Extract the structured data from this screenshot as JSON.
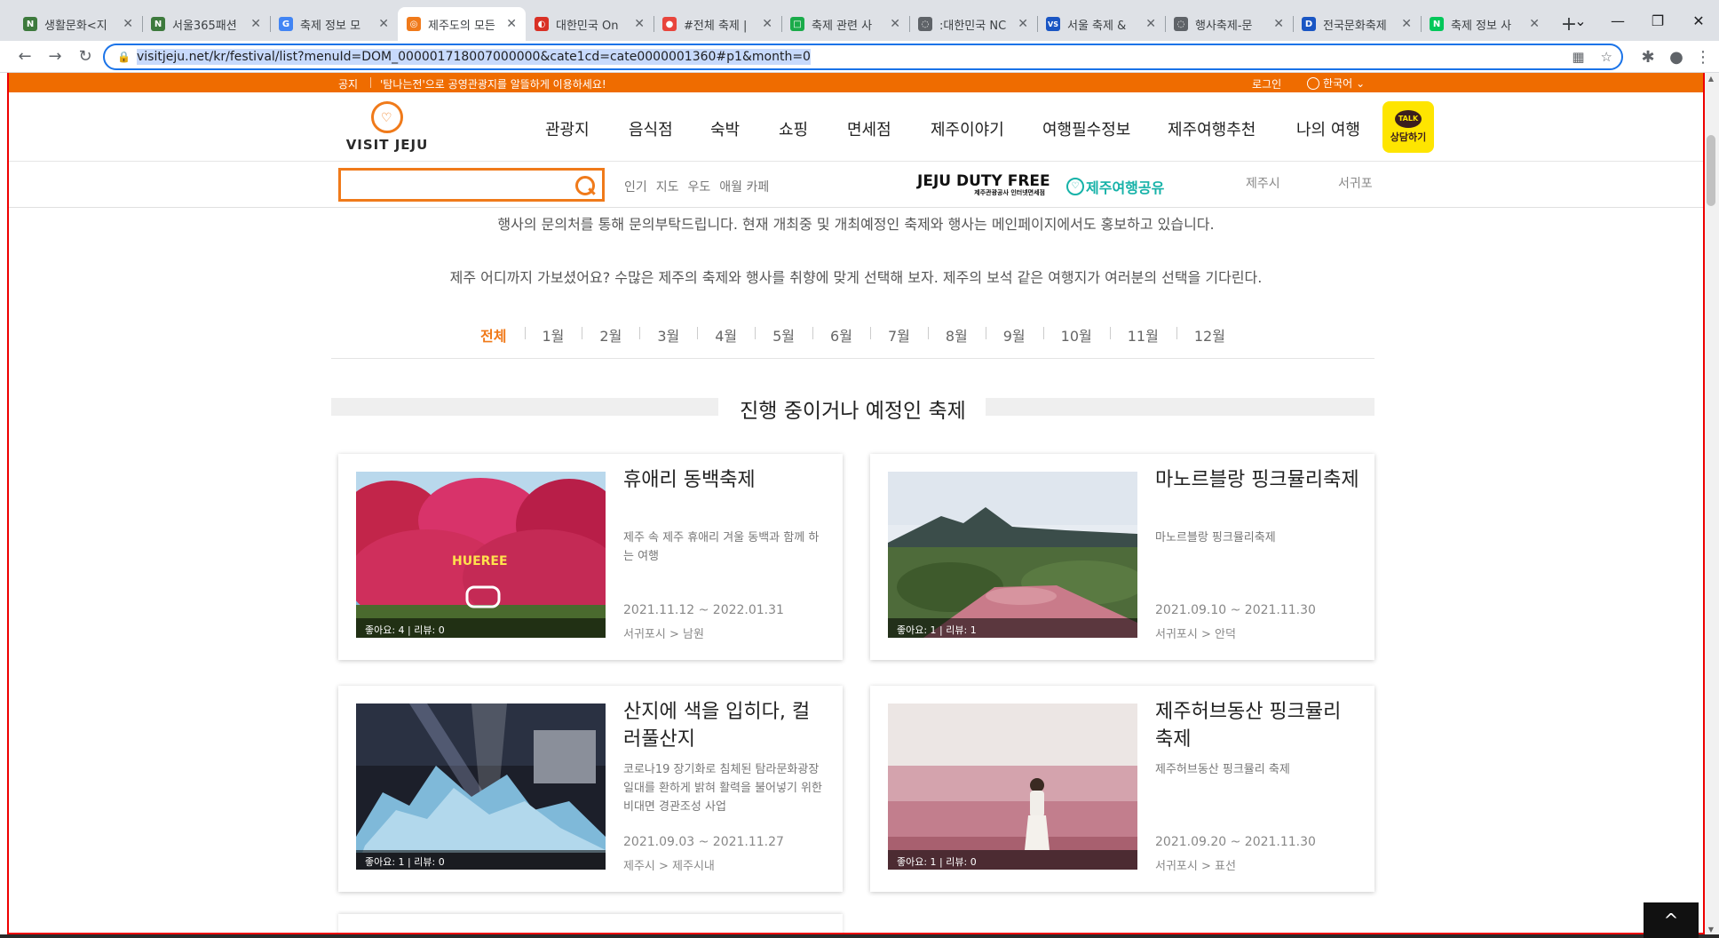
{
  "browser": {
    "tabs": [
      {
        "title": "생활문화<지",
        "fav": "N",
        "color": "#3d7a3d"
      },
      {
        "title": "서울365패션",
        "fav": "N",
        "color": "#3d7a3d"
      },
      {
        "title": "축제 정보 모",
        "fav": "G",
        "color": "#4285f4"
      },
      {
        "title": "제주도의 모든",
        "fav": "◎",
        "color": "#f07a1a"
      },
      {
        "title": "대한민국 On",
        "fav": "◐",
        "color": "#d93025"
      },
      {
        "title": "#전체 축제 |",
        "fav": "●",
        "color": "#e8453c"
      },
      {
        "title": "축제 관련 사",
        "fav": "□",
        "color": "#1aab4a"
      },
      {
        "title": ":대한민국 NC",
        "fav": "◌",
        "color": "#5f6368"
      },
      {
        "title": "서울 축제 &",
        "fav": "VS",
        "color": "#1a56c4"
      },
      {
        "title": "행사축제-문",
        "fav": "◌",
        "color": "#5f6368"
      },
      {
        "title": "전국문화축제",
        "fav": "D",
        "color": "#1a56c4"
      },
      {
        "title": "축제 정보 사",
        "fav": "N",
        "color": "#03c75a"
      }
    ],
    "active_tab": 3,
    "new_tab": "+",
    "url": "visitjeju.net/kr/festival/list?menuId=DOM_000001718007000000&cate1cd=cate0000001360#p1&month=0"
  },
  "notice": {
    "label": "공지",
    "text": "'탐나는전'으로 공영관광지를 알뜰하게 이용하세요!",
    "login": "로그인",
    "language": "한국어"
  },
  "header": {
    "logo": "VISIT JEJU",
    "nav": [
      "관광지",
      "음식점",
      "숙박",
      "쇼핑",
      "면세점",
      "제주이야기",
      "여행필수정보",
      "제주여행추천",
      "나의 여행"
    ],
    "kakao_talk": "TALK",
    "kakao_label": "상담하기"
  },
  "subbar": {
    "search_value": "",
    "hot_keywords": [
      "인기",
      "지도",
      "우도",
      "애월 카페"
    ],
    "dutyfree_main": "JEJU DUTY FREE",
    "dutyfree_sub": "제주관광공사 인터넷면세점",
    "share": "제주여행공유",
    "weather_jeju": "제주시",
    "weather_seogwipo": "서귀포"
  },
  "intro": {
    "line1": "행사의 문의처를 통해 문의부탁드립니다. 현재 개최중 및 개최예정인 축제와 행사는 메인페이지에서도 홍보하고 있습니다.",
    "line2": "제주 어디까지 가보셨어요? 수많은 제주의 축제와 행사를 취향에 맞게 선택해 보자. 제주의 보석 같은 여행지가 여러분의 선택을 기다린다."
  },
  "months": [
    "전체",
    "1월",
    "2월",
    "3월",
    "4월",
    "5월",
    "6월",
    "7월",
    "8월",
    "9월",
    "10월",
    "11월",
    "12월"
  ],
  "active_month": 0,
  "section_title": "진행 중이거나 예정인 축제",
  "festivals": [
    {
      "title": "휴애리 동백축제",
      "desc": "제주 속 제주 휴애리 겨울 동백과 함께 하는 여행",
      "date": "2021.11.12 ~ 2022.01.31",
      "location": "서귀포시 > 남원",
      "stats": "좋아요: 4 |  리뷰: 0",
      "sign": "HUEREE"
    },
    {
      "title": "마노르블랑 핑크뮬리축제",
      "desc": "마노르블랑 핑크뮬리축제",
      "date": "2021.09.10 ~ 2021.11.30",
      "location": "서귀포시 > 안덕",
      "stats": "좋아요: 1 |  리뷰: 1"
    },
    {
      "title": "산지에 색을 입히다, 컬러풀산지",
      "desc": "코로나19 장기화로 침체된 탐라문화광장 일대를 환하게 밝혀 활력을 불어넣기 위한 비대면 경관조성 사업",
      "date": "2021.09.03 ~ 2021.11.27",
      "location": "제주시 > 제주시내",
      "stats": "좋아요: 1 |  리뷰: 0"
    },
    {
      "title": "제주허브동산 핑크뮬리 축제",
      "desc": "제주허브동산 핑크뮬리 축제",
      "date": "2021.09.20 ~ 2021.11.30",
      "location": "서귀포시 > 표선",
      "stats": "좋아요: 1 |  리뷰: 0"
    }
  ],
  "top_button": "^",
  "colors": {
    "accent": "#f07a1a",
    "notice_bar": "#ef6c00",
    "kakao": "#fee500",
    "share": "#16b2a8"
  }
}
